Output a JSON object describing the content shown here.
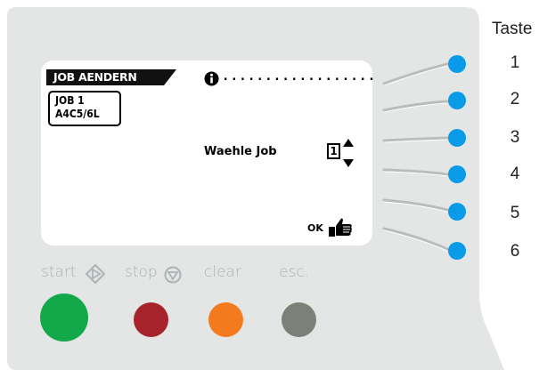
{
  "display": {
    "title": "JOB AENDERN",
    "job_box": {
      "line1": "JOB  1",
      "line2": "A4C5/6L"
    },
    "info_dots": "..................",
    "select_label": "Waehle Job",
    "job_number": "1",
    "ok_label": "OK"
  },
  "softkeys": {
    "header": "Taste",
    "keys": [
      "1",
      "2",
      "3",
      "4",
      "5",
      "6"
    ],
    "led_color": "#0a9be8"
  },
  "buttons": {
    "start": {
      "label": "start",
      "color": "#13a84a"
    },
    "stop": {
      "label": "stop",
      "color": "#a7232b"
    },
    "clear": {
      "label": "clear",
      "color": "#f47a20"
    },
    "esc": {
      "label": "esc.",
      "color": "#7c8077"
    }
  },
  "colors": {
    "panel": "#e3e6e4",
    "screen": "#ffffff",
    "guide_lines": "#b9bdbd"
  }
}
